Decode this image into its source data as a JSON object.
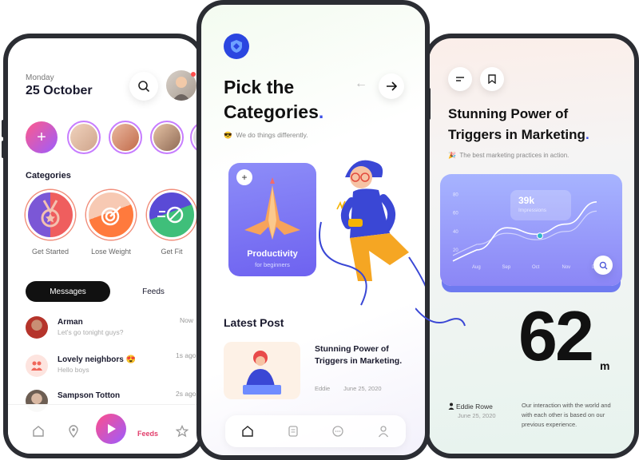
{
  "left_app": {
    "day": "Monday",
    "date": "25 October",
    "categories_title": "Categories",
    "categories": [
      {
        "label": "Get Started",
        "icon": "medal-icon"
      },
      {
        "label": "Lose Weight",
        "icon": "target-icon"
      },
      {
        "label": "Get Fit",
        "icon": "ball-icon"
      }
    ],
    "tabs": {
      "messages": "Messages",
      "feeds": "Feeds"
    },
    "messages": [
      {
        "name": "Arman",
        "text": "Let's go tonight guys?",
        "time": "Now"
      },
      {
        "name": "Lovely neighbors 😍",
        "text": "Hello boys",
        "time": "1s ago"
      },
      {
        "name": "Sampson Totton",
        "text": "",
        "time": "2s ago"
      }
    ],
    "bottom_nav": {
      "active_label": "Feeds"
    },
    "colors": {
      "accent": "#e23d6b",
      "purple": "#9b5cff"
    }
  },
  "center_app": {
    "title_line1": "Pick the",
    "title_line2": "Categories",
    "title_dot": ".",
    "tagline_emoji": "😎",
    "tagline": "We do things differently.",
    "card": {
      "title": "Productivity",
      "subtitle": "for beginners",
      "plus": "+"
    },
    "latest_post_title": "Latest Post",
    "post": {
      "title": "Stunning Power of Triggers in Marketing.",
      "author": "Eddie",
      "date": "June 25, 2020"
    },
    "colors": {
      "accent": "#3b4ee6",
      "card": "#7a70f2"
    }
  },
  "right_app": {
    "title": "Stunning Power of Triggers in Marketing",
    "title_dot": ".",
    "tagline_emoji": "🎉",
    "tagline": "The best marketing practices in action.",
    "chart_tooltip": {
      "value": "39k",
      "label": "Impressions"
    },
    "big_number": "62",
    "unit": "m",
    "author": "Eddie Rowe",
    "date": "June 25, 2020",
    "description": "Our interaction with the world and with each other is based on our previous experience."
  },
  "chart_data": {
    "type": "line",
    "categories": [
      "Aug",
      "Sep",
      "Oct",
      "Nov",
      "Dec"
    ],
    "y_ticks": [
      "80",
      "60",
      "40",
      "20"
    ],
    "series": [
      {
        "values": [
          20,
          44,
          37,
          48,
          72
        ]
      },
      {
        "values": [
          26,
          38,
          31,
          40,
          62
        ]
      }
    ],
    "ylim": [
      0,
      90
    ],
    "grid": false
  }
}
